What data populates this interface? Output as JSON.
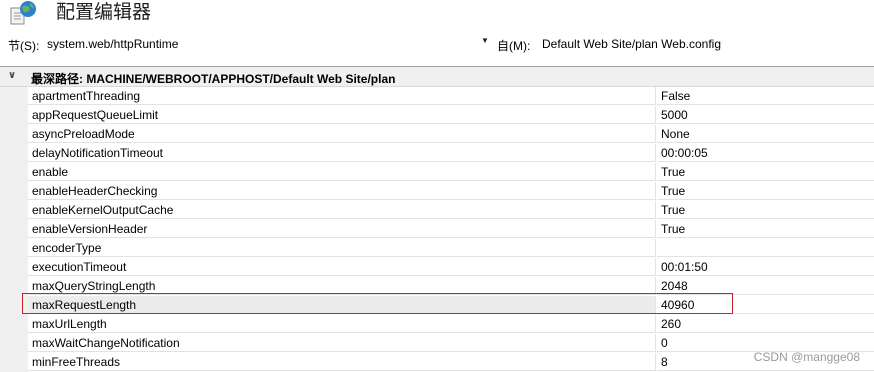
{
  "header": {
    "title": "配置编辑器"
  },
  "toolbar": {
    "section_label": "节(S):",
    "section_value": "system.web/httpRuntime",
    "from_label": "自(M):",
    "from_value": "Default Web Site/plan Web.config"
  },
  "group": {
    "title": "最深路径: MACHINE/WEBROOT/APPHOST/Default Web Site/plan"
  },
  "rows": [
    {
      "name": "apartmentThreading",
      "value": "False"
    },
    {
      "name": "appRequestQueueLimit",
      "value": "5000"
    },
    {
      "name": "asyncPreloadMode",
      "value": "None"
    },
    {
      "name": "delayNotificationTimeout",
      "value": "00:00:05"
    },
    {
      "name": "enable",
      "value": "True"
    },
    {
      "name": "enableHeaderChecking",
      "value": "True"
    },
    {
      "name": "enableKernelOutputCache",
      "value": "True"
    },
    {
      "name": "enableVersionHeader",
      "value": "True"
    },
    {
      "name": "encoderType",
      "value": ""
    },
    {
      "name": "executionTimeout",
      "value": "00:01:50"
    },
    {
      "name": "maxQueryStringLength",
      "value": "2048"
    },
    {
      "name": "maxRequestLength",
      "value": "40960"
    },
    {
      "name": "maxUrlLength",
      "value": "260"
    },
    {
      "name": "maxWaitChangeNotification",
      "value": "0"
    },
    {
      "name": "minFreeThreads",
      "value": "8"
    }
  ],
  "watermark": "CSDN @mangge08"
}
